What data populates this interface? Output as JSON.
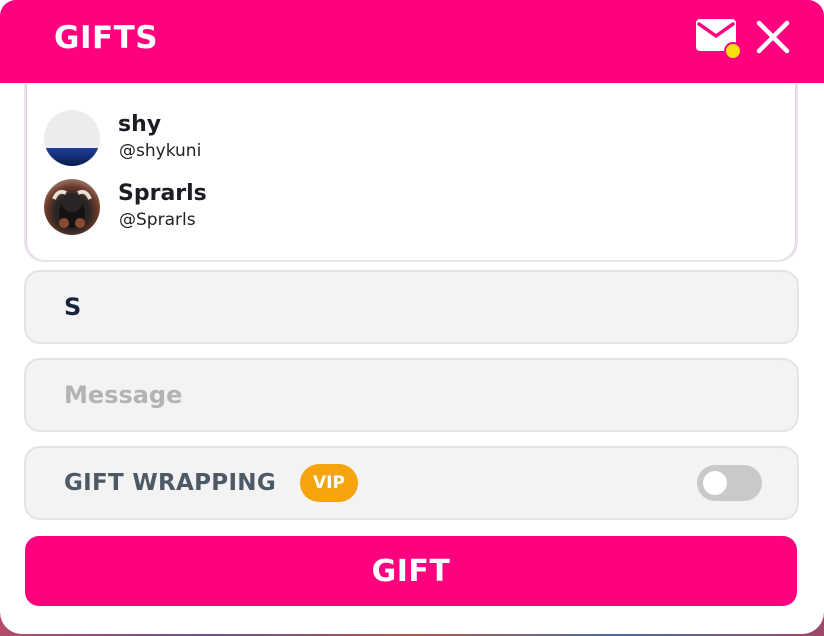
{
  "header": {
    "title": "GIFTS",
    "mail_icon": "mail-icon",
    "notification_color": "#f5e20a",
    "close_icon": "close-icon"
  },
  "dropdown": {
    "users": [
      {
        "name": "shy",
        "handle": "@shykuni"
      },
      {
        "name": "Sprarls",
        "handle": "@Sprarls"
      }
    ]
  },
  "form": {
    "recipient_value": "S",
    "message_placeholder": "Message",
    "message_value": "",
    "gift_wrapping_label": "GIFT WRAPPING",
    "vip_badge": "VIP",
    "gift_wrapping_enabled": false
  },
  "actions": {
    "gift_label": "GIFT"
  },
  "colors": {
    "brand": "#ff007f",
    "vip": "#f5a40b",
    "toggle_off": "#c9c9c9"
  }
}
